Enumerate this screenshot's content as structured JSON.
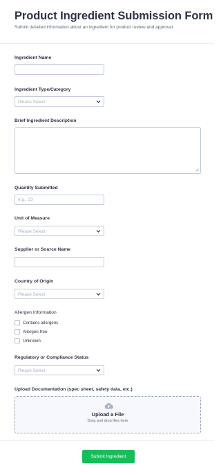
{
  "form": {
    "title": "Product Ingredient Submission Form",
    "subtitle": "Submit detailed information about an ingredient for product review and approval."
  },
  "fields": {
    "ingredient_name": {
      "label": "Ingredient Name",
      "value": ""
    },
    "ingredient_type": {
      "label": "Ingredient Type/Category",
      "selected": "Please Select"
    },
    "description": {
      "label": "Brief Ingredient Description",
      "value": ""
    },
    "quantity": {
      "label": "Quantity Submitted",
      "placeholder": "e.g., 23"
    },
    "unit": {
      "label": "Unit of Measure",
      "selected": "Please Select"
    },
    "supplier": {
      "label": "Supplier or Source Name",
      "value": ""
    },
    "country": {
      "label": "Country of Origin",
      "selected": "Please Select"
    },
    "allergen": {
      "label": "Allergen Information",
      "options": [
        "Contains allergens",
        "Allergen-free",
        "Unknown"
      ]
    },
    "regulatory": {
      "label": "Regulatory or Compliance Status",
      "selected": "Please Select"
    },
    "upload": {
      "label": "Upload Documentation (spec sheet, safety data, etc.)",
      "title": "Upload a File",
      "subtitle": "Drag and drop files here",
      "icon": "cloud-upload-icon"
    }
  },
  "submit": {
    "label": "Submit Ingredient"
  },
  "colors": {
    "accent": "#18bd5b",
    "text": "#2c3345",
    "border": "#c3cad8",
    "placeholder": "#a7b0c2"
  }
}
